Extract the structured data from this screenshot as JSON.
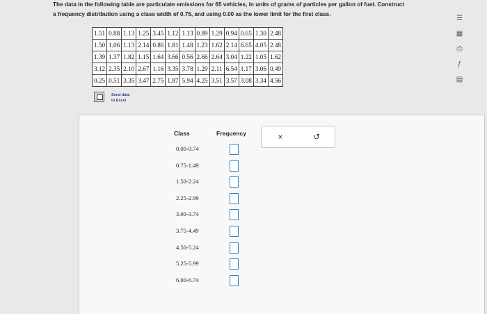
{
  "question": {
    "line1": "The data in the following table are particulate emissions for 65 vehicles, in units of grams of particles per gallon of fuel. Construct",
    "line2": "a frequency distribution using a class width of 0.75, and using 0.00 as the lower limit for the first class."
  },
  "data_table": [
    [
      "1.51",
      "0.88",
      "1.13",
      "1.25",
      "3.45",
      "1.12",
      "1.13",
      "0.89",
      "1.29",
      "0.94",
      "0.65",
      "1.30",
      "2.48"
    ],
    [
      "1.50",
      "1.06",
      "1.13",
      "2.14",
      "0.86",
      "1.81",
      "1.48",
      "1.23",
      "1.62",
      "2.14",
      "6.65",
      "4.05",
      "2.48"
    ],
    [
      "1.39",
      "1.37",
      "1.82",
      "1.15",
      "1.64",
      "3.66",
      "0.56",
      "2.66",
      "2.64",
      "3.04",
      "1.22",
      "1.05",
      "1.62"
    ],
    [
      "3.12",
      "2.35",
      "2.10",
      "2.67",
      "1.16",
      "3.35",
      "3.78",
      "1.29",
      "2.11",
      "6.54",
      "1.17",
      "3.06",
      "0.49"
    ],
    [
      "0.25",
      "0.51",
      "3.35",
      "3.47",
      "2.75",
      "1.87",
      "5.94",
      "4.25",
      "3.51",
      "3.57",
      "3.08",
      "3.34",
      "4.56"
    ]
  ],
  "excel": {
    "line1": "Send data",
    "line2": "to Excel"
  },
  "freq_table": {
    "class_header": "Class",
    "frequency_header": "Frequency",
    "classes": [
      "0.00-0.74",
      "0.75-1.49",
      "1.50-2.24",
      "2.25-2.99",
      "3.00-3.74",
      "3.75-4.49",
      "4.50-5.24",
      "5.25-5.99",
      "6.00-6.74"
    ],
    "frequencies": [
      "",
      "",
      "",
      "",
      "",
      "",
      "",
      "",
      ""
    ]
  },
  "actions": {
    "clear_icon": "close-icon",
    "clear_glyph": "×",
    "undo_icon": "undo-icon",
    "undo_glyph": "↺"
  },
  "side_tools": [
    {
      "icon": "notes-icon",
      "glyph": "☰"
    },
    {
      "icon": "calculator-icon",
      "glyph": "▦"
    },
    {
      "icon": "print-icon",
      "glyph": "⎙"
    },
    {
      "icon": "formula-icon",
      "glyph": "ƒ"
    },
    {
      "icon": "book-icon",
      "glyph": "▤"
    }
  ],
  "colors": {
    "input_border": "#2f86c6",
    "panel_bg": "#f8f8f8",
    "page_bg": "#e9e9ea"
  }
}
